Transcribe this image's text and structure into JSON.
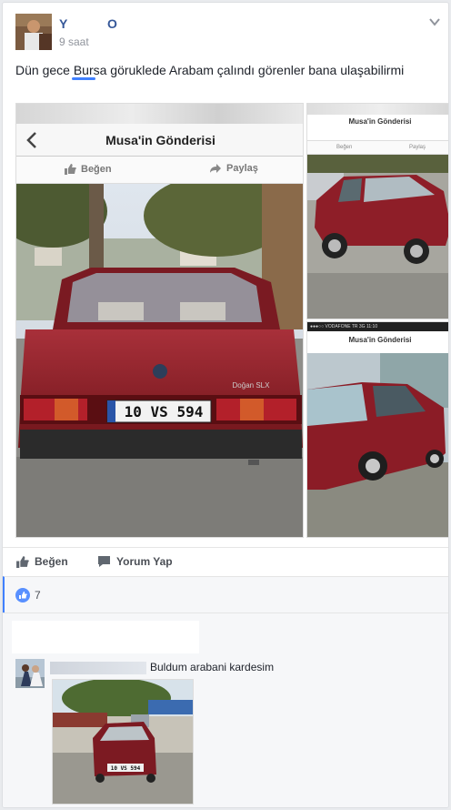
{
  "post": {
    "author": "Y O",
    "time": "9 saat",
    "text": "Dün gece Bursa göruklede Arabam çalındı görenler bana ulaşabilirmi"
  },
  "screenshot_main": {
    "title": "Musa'in Gönderisi",
    "like_label": "Beğen",
    "share_label": "Paylaş",
    "plate": "10 VS 594",
    "badge": "Doğan SLX"
  },
  "screenshot_small_1": {
    "title": "Musa'in Gönderisi",
    "like_label": "Beğen",
    "share_label": "Paylaş"
  },
  "screenshot_small_2": {
    "title": "Musa'in Gönderisi",
    "status": "●●●○○ VODAFONE TR 3G 11:10"
  },
  "actions": {
    "like_label": "Beğen",
    "comment_label": "Yorum Yap"
  },
  "reactions": {
    "count": "7"
  },
  "comment": {
    "text": "Buldum arabani kardesim",
    "plate": "10 VS 594"
  },
  "colors": {
    "link_blue": "#365899",
    "accent_blue": "#4080ff",
    "car_red": "#8b1c24"
  }
}
